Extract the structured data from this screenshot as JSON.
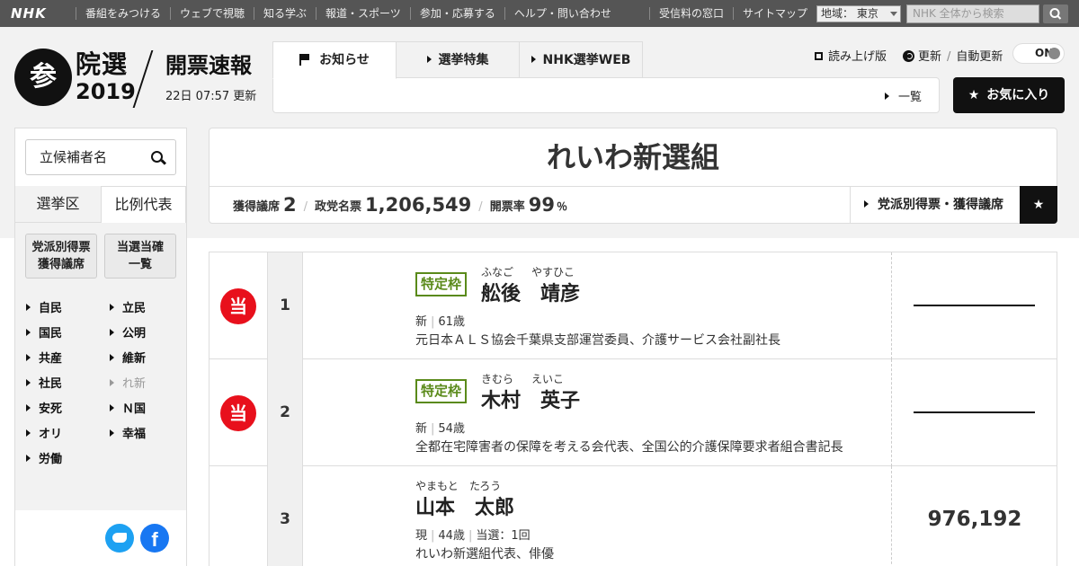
{
  "topbar": {
    "logo": "NHK",
    "nav": [
      "番組をみつける",
      "ウェブで視聴",
      "知る学ぶ",
      "報道・スポーツ",
      "参加・応募する",
      "ヘルプ・問い合わせ"
    ],
    "right": [
      "受信料の窓口",
      "サイトマップ"
    ],
    "region": "地域： 東京",
    "search_placeholder": "NHK 全体から検索"
  },
  "header": {
    "logo_badge": "参",
    "logo_main": "院選",
    "logo_year": "2019",
    "title": "開票速報",
    "updated": "22日 07:57 更新",
    "tabs": [
      "お知らせ",
      "選挙特集",
      "NHK選挙WEB"
    ],
    "list_link": "一覧",
    "readaloud": "読み上げ版",
    "refresh": "更新",
    "auto_refresh": "自動更新",
    "toggle": "ON",
    "favorites": "お気に入り"
  },
  "sidebar": {
    "search_placeholder": "立候補者名",
    "tabs": [
      "選挙区",
      "比例代表"
    ],
    "buttons": [
      "党派別得票\n獲得議席",
      "当選当確\n一覧"
    ],
    "parties_left": [
      "自民",
      "国民",
      "共産",
      "社民",
      "安死",
      "オリ",
      "労働"
    ],
    "parties_right": [
      "立民",
      "公明",
      "維新",
      "れ新",
      "Ｎ国",
      "幸福"
    ]
  },
  "party": {
    "name": "れいわ新選組",
    "seats_label": "獲得議席",
    "seats": "2",
    "votes_label": "政党名票",
    "votes": "1,206,549",
    "count_label": "開票率",
    "count_rate": "99",
    "count_unit": "％",
    "link": "党派別得票・獲得議席"
  },
  "candidates": [
    {
      "rank": "1",
      "elected": "当",
      "tag": "特定枠",
      "furi_last": "ふなご",
      "furi_first": "やすひこ",
      "last": "舩後",
      "first": "靖彦",
      "status": "新",
      "age": "61歳",
      "terms": "",
      "career": "元日本ＡＬＳ協会千葉県支部運営委員、介護サービス会社副社長",
      "votes": ""
    },
    {
      "rank": "2",
      "elected": "当",
      "tag": "特定枠",
      "furi_last": "きむら",
      "furi_first": "えいこ",
      "last": "木村",
      "first": "英子",
      "status": "新",
      "age": "54歳",
      "terms": "",
      "career": "全都在宅障害者の保障を考える会代表、全国公的介護保障要求者組合書記長",
      "votes": ""
    },
    {
      "rank": "3",
      "elected": "",
      "tag": "",
      "furi_last": "やまもと",
      "furi_first": "たろう",
      "last": "山本",
      "first": "太郎",
      "status": "現",
      "age": "44歳",
      "terms": "当選：1回",
      "career": "れいわ新選組代表、俳優",
      "votes": "976,192"
    }
  ]
}
